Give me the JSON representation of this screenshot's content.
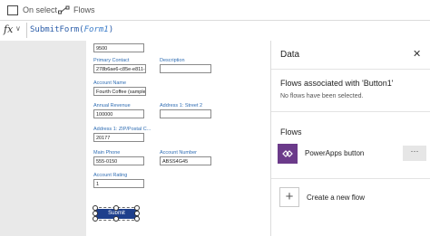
{
  "toolbar": {
    "on_select_label": "On select",
    "flows_label": "Flows"
  },
  "formula_bar": {
    "fx_label": "fx",
    "function_name": "SubmitForm(",
    "argument": "Form1",
    "closing": ")"
  },
  "form": {
    "top_value": "9500",
    "primary_contact_label": "Primary Contact",
    "primary_contact_value": "278b6ae6-c85e-e811-a9",
    "description_label": "Description",
    "account_name_label": "Account Name",
    "account_name_value": "Fourth Coffee (sample)",
    "annual_revenue_label": "Annual Revenue",
    "annual_revenue_value": "100000",
    "street2_label": "Address 1: Street 2",
    "zip_label": "Address 1: ZIP/Postal C...",
    "zip_value": "20177",
    "main_phone_label": "Main Phone",
    "main_phone_value": "555-0150",
    "account_number_label": "Account Number",
    "account_number_value": "ABSS4G45",
    "account_rating_label": "Account Rating",
    "account_rating_value": "1",
    "submit_label": "Submit"
  },
  "data_pane": {
    "title": "Data",
    "associated_heading": "Flows associated with 'Button1'",
    "no_flows_text": "No flows have been selected.",
    "flows_heading": "Flows",
    "flow_item_label": "PowerApps button",
    "more_label": "···",
    "create_label": "Create a new flow",
    "flow_icon_color": "#6b3a8a"
  }
}
